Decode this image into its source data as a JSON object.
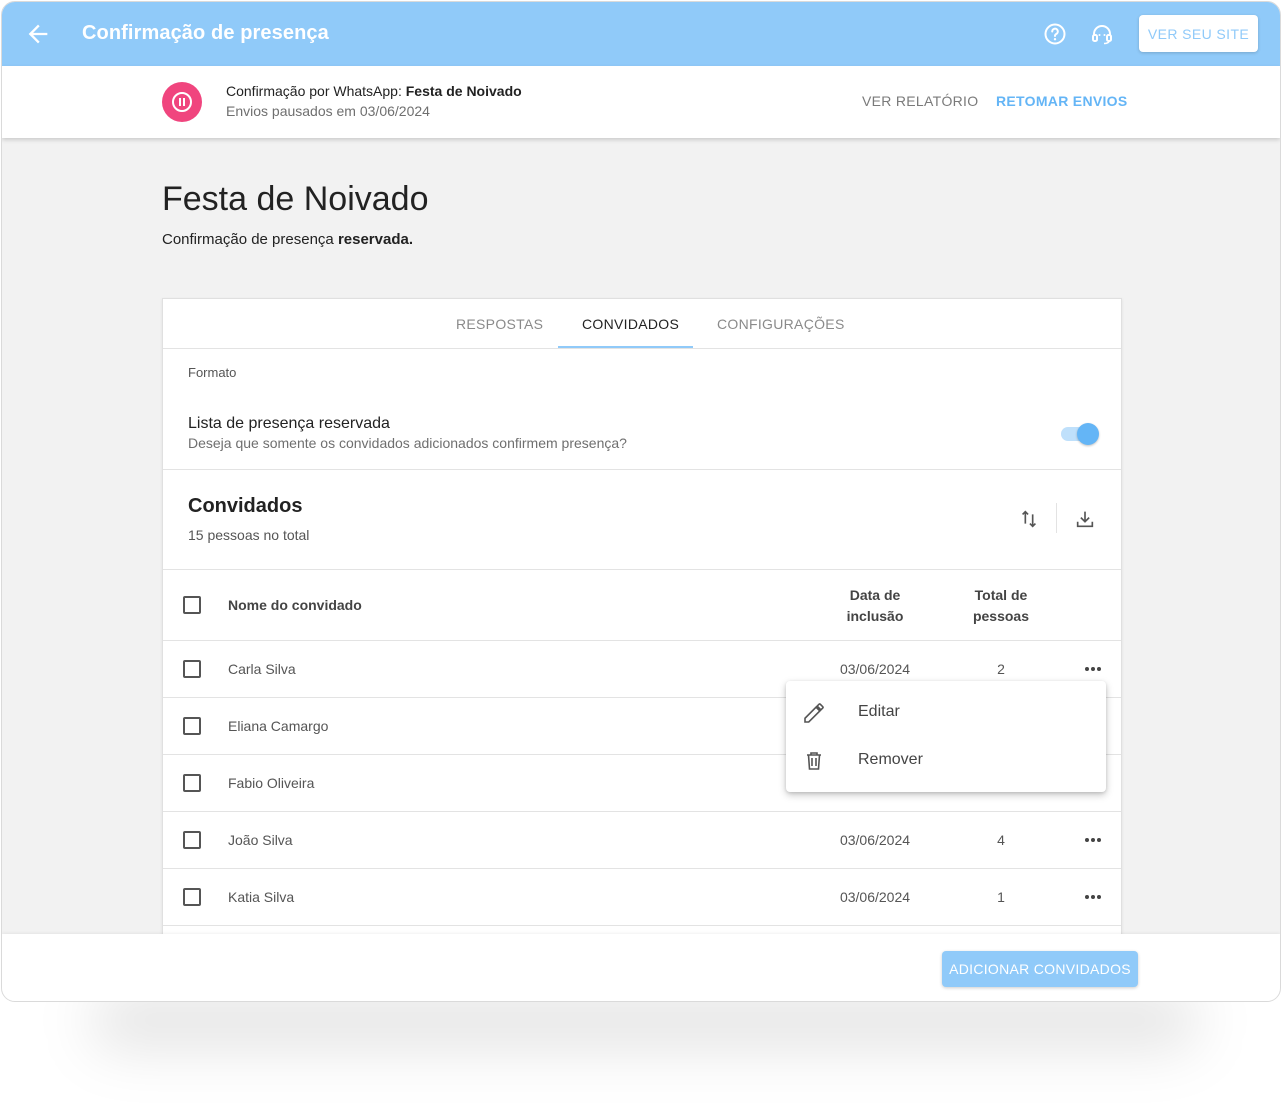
{
  "appbar": {
    "title": "Confirmação de presença",
    "site_button": "VER SEU SITE",
    "icons": [
      "back-arrow-icon",
      "help-icon",
      "support-icon"
    ]
  },
  "status": {
    "line1_prefix": "Confirmação por WhatsApp: ",
    "line1_event": "Festa de Noivado",
    "line2": "Envios pausados em 03/06/2024",
    "report_button": "VER RELATÓRIO",
    "resume_button": "RETOMAR ENVIOS",
    "pause_color": "#f0457e"
  },
  "page": {
    "title": "Festa de Noivado",
    "subtitle_prefix": "Confirmação de presença ",
    "subtitle_bold": "reservada."
  },
  "tabs": [
    {
      "label": "RESPOSTAS",
      "active": false
    },
    {
      "label": "CONVIDADOS",
      "active": true
    },
    {
      "label": "CONFIGURAÇÕES",
      "active": false
    }
  ],
  "format": {
    "label": "Formato",
    "option_title": "Lista de presença reservada",
    "option_desc": "Deseja que somente os convidados adicionados confirmem presença?",
    "toggle_on": true
  },
  "guests": {
    "title": "Convidados",
    "count": "15 pessoas no total",
    "headers": {
      "name": "Nome do convidado",
      "date_l1": "Data de",
      "date_l2": "inclusão",
      "total_l1": "Total de",
      "total_l2": "pessoas"
    },
    "rows": [
      {
        "name": "Carla Silva",
        "date": "03/06/2024",
        "total": "2"
      },
      {
        "name": "Eliana Camargo",
        "date": "",
        "total": ""
      },
      {
        "name": "Fabio Oliveira",
        "date": "",
        "total": ""
      },
      {
        "name": "João Silva",
        "date": "03/06/2024",
        "total": "4"
      },
      {
        "name": "Katia Silva",
        "date": "03/06/2024",
        "total": "1"
      }
    ]
  },
  "menu": {
    "items": [
      {
        "label": "Editar",
        "icon": "pencil-icon"
      },
      {
        "label": "Remover",
        "icon": "trash-icon"
      }
    ]
  },
  "footer": {
    "add_button": "ADICIONAR CONVIDADOS"
  },
  "colors": {
    "primary": "#90caf9",
    "accent_text": "#64b5f6",
    "pause": "#f0457e"
  }
}
